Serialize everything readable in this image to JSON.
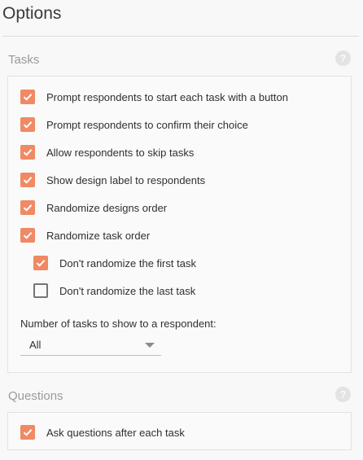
{
  "page": {
    "title": "Options"
  },
  "tasks_section": {
    "heading": "Tasks",
    "help_glyph": "?",
    "items": [
      {
        "label": "Prompt respondents to start each task with a button",
        "checked": true
      },
      {
        "label": "Prompt respondents to confirm their choice",
        "checked": true
      },
      {
        "label": "Allow respondents to skip tasks",
        "checked": true
      },
      {
        "label": "Show design label to respondents",
        "checked": true
      },
      {
        "label": "Randomize designs order",
        "checked": true
      },
      {
        "label": "Randomize task order",
        "checked": true
      }
    ],
    "sub_items": [
      {
        "label": "Don't randomize the first task",
        "checked": true
      },
      {
        "label": "Don't randomize the last task",
        "checked": false
      }
    ],
    "count_field": {
      "label": "Number of tasks to show to a respondent:",
      "value": "All"
    }
  },
  "questions_section": {
    "heading": "Questions",
    "help_glyph": "?",
    "items": [
      {
        "label": "Ask questions after each task",
        "checked": true
      }
    ]
  },
  "colors": {
    "accent": "#ef8a64",
    "unchecked_border": "#757575",
    "heading": "#9a9a9a"
  }
}
